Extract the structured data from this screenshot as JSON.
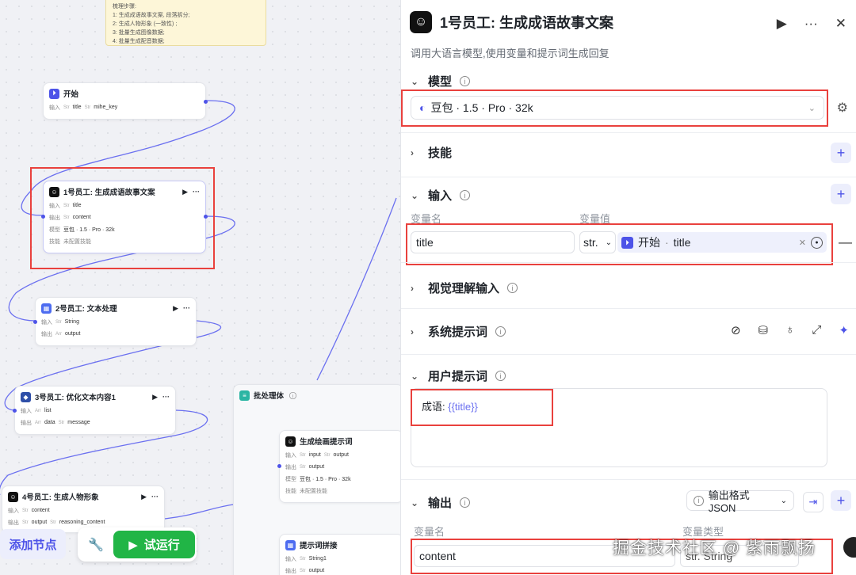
{
  "note": {
    "title": "梳理步骤:",
    "lines": [
      "1: 生成成语故事文案, 段落拆分;",
      "2: 生成人物形象 (一致性) ;",
      "3: 批量生成图像数据;",
      "4: 批量生成配音数据;"
    ]
  },
  "nodes": {
    "start": {
      "title": "开始",
      "row1_label": "输入",
      "row1_vals": [
        "title",
        "mihe_key"
      ]
    },
    "n1": {
      "title": "1号员工: 生成成语故事文案",
      "in_label": "输入",
      "in_val": "title",
      "out_label": "输出",
      "out_val": "content",
      "model_label": "模型",
      "model_val": "豆包 · 1.5 · Pro · 32k",
      "skill_label": "技能",
      "skill_val": "未配置技能"
    },
    "n2": {
      "title": "2号员工: 文本处理",
      "in_label": "输入",
      "in_val": "String",
      "out_label": "输出",
      "out_val": "output"
    },
    "n3": {
      "title": "3号员工: 优化文本内容1",
      "in_label": "输入",
      "in_val": "list",
      "out_label": "输出",
      "out_vals": [
        "data",
        "message"
      ]
    },
    "n4": {
      "title": "4号员工: 生成人物形象",
      "in_label": "输入",
      "in_val": "content",
      "out_label": "输出",
      "out_vals": [
        "output",
        "reasoning_content"
      ]
    },
    "batch": {
      "title": "批处理体"
    },
    "draw": {
      "title": "生成绘画提示词",
      "in_label": "输入",
      "in_vals": [
        "input",
        "output"
      ],
      "out_label": "输出",
      "out_val": "output",
      "model_label": "模型",
      "model_val": "豆包 · 1.5 · Pro · 32k",
      "skill_label": "技能",
      "skill_val": "未配置技能"
    },
    "concat": {
      "title": "提示词拼接",
      "in_label": "输入",
      "in_val": "String1",
      "out_label": "输出",
      "out_val": "output"
    }
  },
  "toolbar": {
    "add_label": "添加节点",
    "run_label": "试运行"
  },
  "panel": {
    "title": "1号员工: 生成成语故事文案",
    "subtitle": "调用大语言模型,使用变量和提示词生成回复",
    "model": {
      "label": "模型",
      "value": "豆包 · 1.5 · Pro · 32k"
    },
    "skills": {
      "label": "技能"
    },
    "input": {
      "label": "输入",
      "name_header": "变量名",
      "value_header": "变量值",
      "name_value": "title",
      "type_value": "str.",
      "ref_source": "开始",
      "ref_var": "title"
    },
    "vision": {
      "label": "视觉理解输入"
    },
    "system_prompt": {
      "label": "系统提示词"
    },
    "user_prompt": {
      "label": "用户提示词",
      "prefix": "成语: ",
      "var": "{{title}}"
    },
    "output": {
      "label": "输出",
      "format": "输出格式JSON",
      "name_header": "变量名",
      "type_header": "变量类型",
      "name_value": "content",
      "type_value": "str. String"
    }
  },
  "watermark": "掘金技术社区 @ 紫雨飘扬",
  "colors": {
    "accent": "#4d53e8",
    "run": "#21b546",
    "highlight": "#e9413d"
  }
}
